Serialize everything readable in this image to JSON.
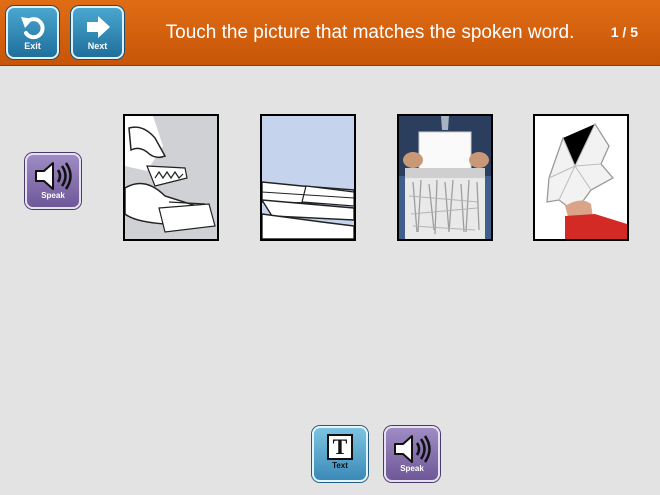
{
  "header": {
    "exit_label": "Exit",
    "next_label": "Next",
    "instruction": "Touch the picture that matches the spoken word.",
    "progress": "1 / 5"
  },
  "speak_side": {
    "label": "Speak",
    "icon": "speaker-icon"
  },
  "choices": [
    {
      "icon": "tearing-paper-picture"
    },
    {
      "icon": "stacked-paper-picture"
    },
    {
      "icon": "paper-shredder-picture"
    },
    {
      "icon": "crumpled-paper-picture"
    }
  ],
  "bottom_toolbar": {
    "text_label": "Text",
    "text_glyph": "T",
    "speak_label": "Speak"
  },
  "colors": {
    "header": "#d2600c",
    "nav_button": "#2f86b5",
    "speak_button": "#8672ad",
    "background": "#e3e3e3"
  }
}
